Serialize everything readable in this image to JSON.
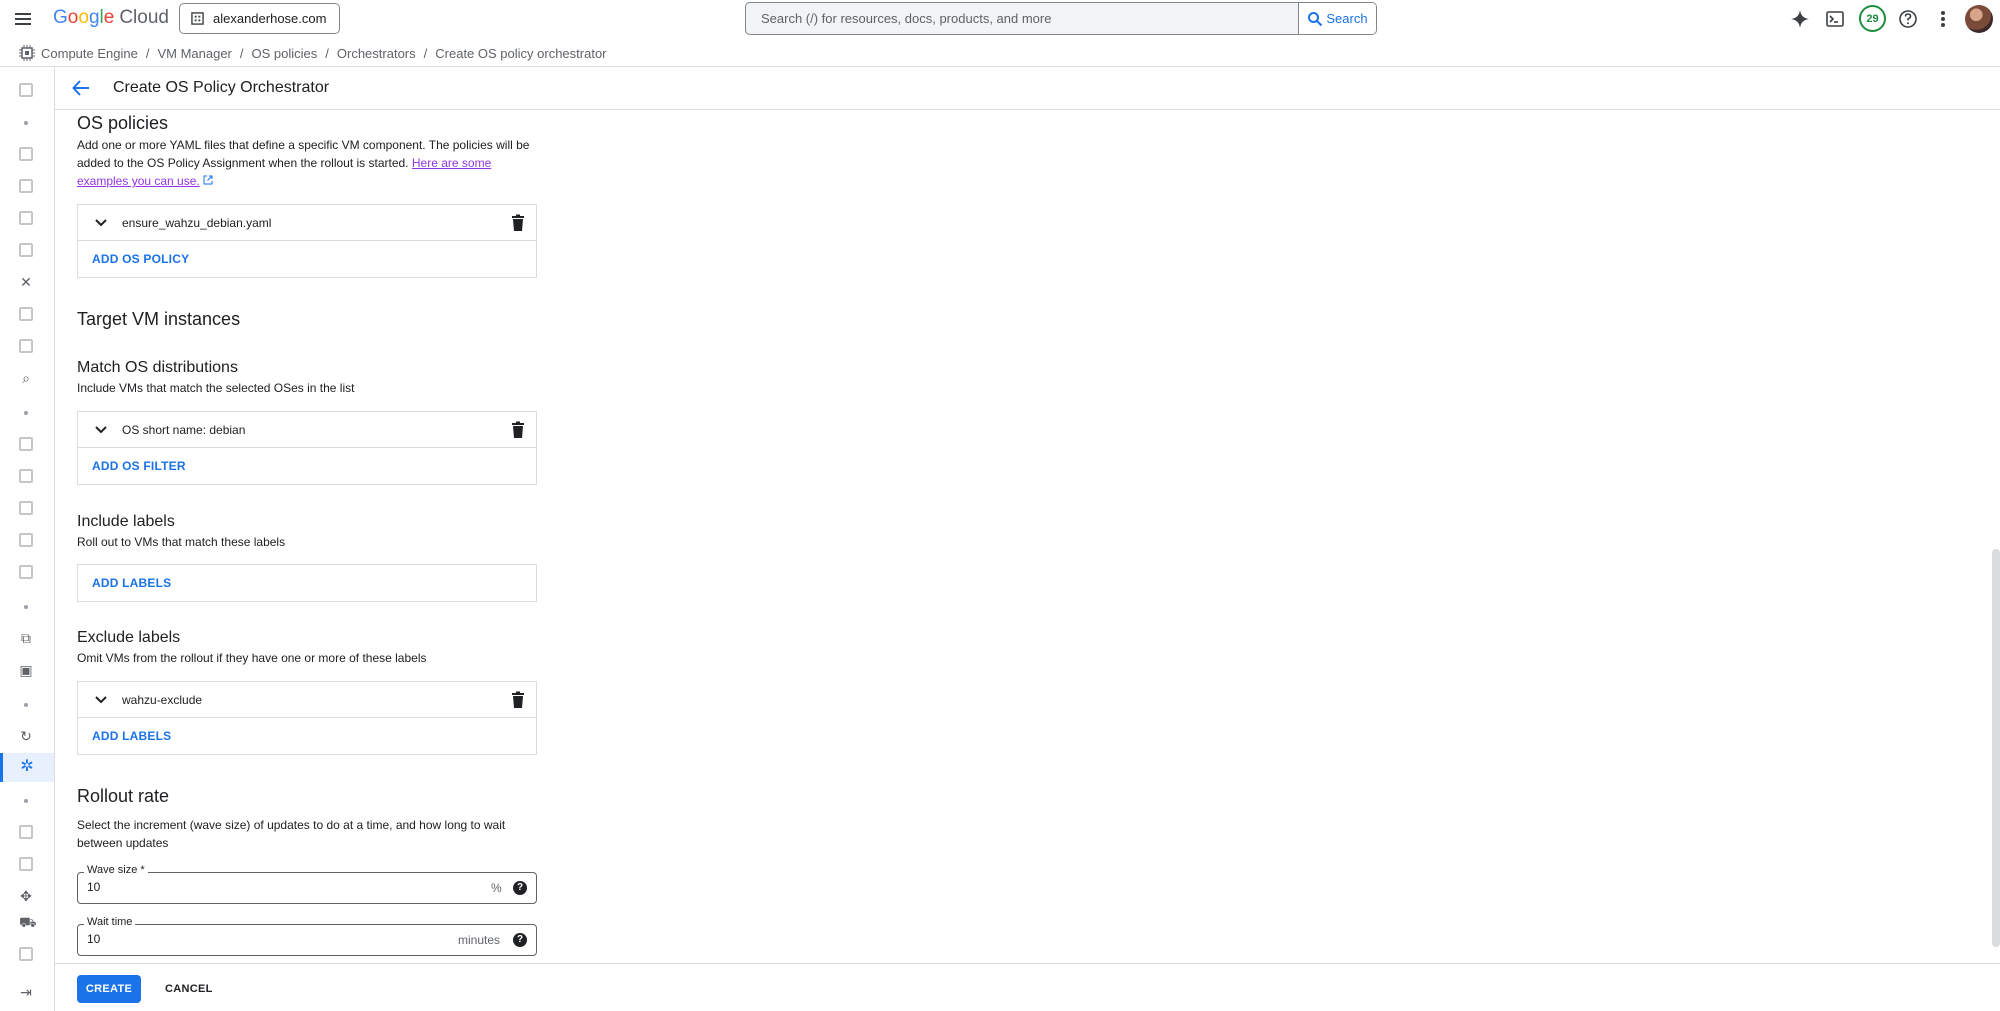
{
  "topbar": {
    "logo_letters": [
      "G",
      "o",
      "o",
      "g",
      "l",
      "e"
    ],
    "logo_product": "Cloud",
    "project": "alexanderhose.com",
    "search_placeholder": "Search (/) for resources, docs, products, and more",
    "search_button": "Search",
    "notification_count": "29",
    "icons": [
      "gemini-icon",
      "cloud-shell-icon",
      "help-icon",
      "more-vert-icon"
    ]
  },
  "breadcrumb": {
    "items": [
      "Compute Engine",
      "VM Manager",
      "OS policies",
      "Orchestrators",
      "Create OS policy orchestrator"
    ],
    "separator": "/"
  },
  "page": {
    "title": "Create OS Policy Orchestrator"
  },
  "os_policies": {
    "heading": "OS policies",
    "description": "Add one or more YAML files that define a specific VM component. The policies will be added to the OS Policy Assignment when the rollout is started.",
    "examples_link": "Here are some examples you can use.",
    "items": [
      "ensure_wahzu_debian.yaml"
    ],
    "add_label": "ADD OS POLICY"
  },
  "target_vm": {
    "heading": "Target VM instances"
  },
  "match_os": {
    "heading": "Match OS distributions",
    "description": "Include VMs that match the selected OSes in the list",
    "items": [
      "OS short name: debian"
    ],
    "add_label": "ADD OS FILTER"
  },
  "include_labels": {
    "heading": "Include labels",
    "description": "Roll out to VMs that match these labels",
    "add_label": "ADD LABELS"
  },
  "exclude_labels": {
    "heading": "Exclude labels",
    "description": "Omit VMs from the rollout if they have one or more of these labels",
    "items": [
      "wahzu-exclude"
    ],
    "add_label": "ADD LABELS"
  },
  "rollout_rate": {
    "heading": "Rollout rate",
    "description": "Select the increment (wave size) of updates to do at a time, and how long to wait between updates",
    "wave_size": {
      "label": "Wave size *",
      "value": "10",
      "suffix": "%"
    },
    "wait_time": {
      "label": "Wait time",
      "value": "10",
      "suffix": "minutes"
    }
  },
  "footer": {
    "create_label": "CREATE",
    "cancel_label": "CANCEL"
  },
  "colors": {
    "accent": "#1a73e8",
    "link_visited": "#9334e6",
    "notification_green": "#1e8e3e"
  }
}
